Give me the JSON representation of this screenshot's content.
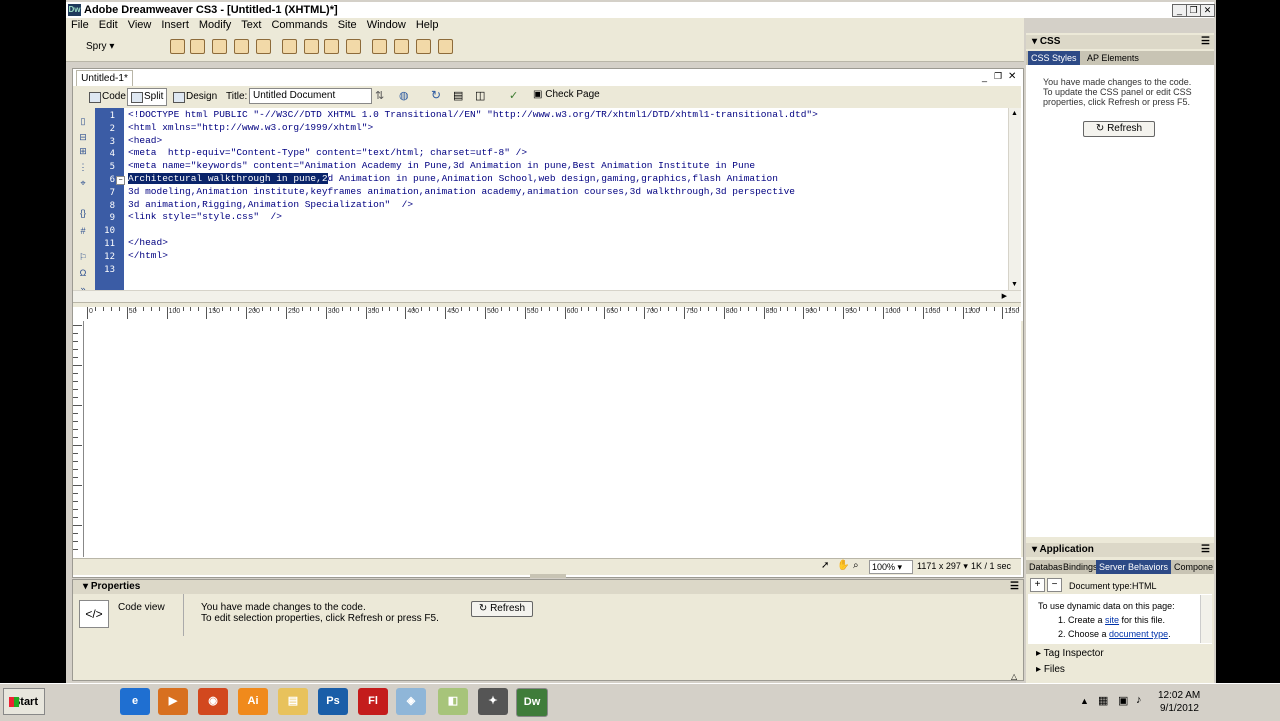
{
  "window": {
    "title": "Adobe Dreamweaver CS3 - [Untitled-1 (XHTML)*]",
    "logo": "Dw"
  },
  "menu": [
    "File",
    "Edit",
    "View",
    "Insert",
    "Modify",
    "Text",
    "Commands",
    "Site",
    "Window",
    "Help"
  ],
  "insert_bar": {
    "category": "Spry"
  },
  "document": {
    "tab": "Untitled-1*",
    "views": {
      "code": "Code",
      "split": "Split",
      "design": "Design",
      "active": "Split"
    },
    "title_label": "Title:",
    "title_value": "Untitled Document",
    "check_page": "Check Page"
  },
  "code_lines": [
    {
      "n": "1",
      "text": "<!DOCTYPE html PUBLIC \"-//W3C//DTD XHTML 1.0 Transitional//EN\" \"http://www.w3.org/TR/xhtml1/DTD/xhtml1-transitional.dtd\">"
    },
    {
      "n": "2",
      "text": "<html xmlns=\"http://www.w3.org/1999/xhtml\">"
    },
    {
      "n": "3",
      "text": "<head>"
    },
    {
      "n": "4",
      "text": "<meta  http-equiv=\"Content-Type\" content=\"text/html; charset=utf-8\" />"
    },
    {
      "n": "5",
      "text": "<meta name=\"keywords\" content=\"Animation Academy in Pune,3d Animation in pune,Best Animation Institute in Pune"
    },
    {
      "n": "6",
      "selected": "Architectural walkthrough in pune,2",
      "text": "d Animation in pune,Animation School,web design,gaming,graphics,flash Animation"
    },
    {
      "n": "7",
      "text": "3d modeling,Animation institute,keyframes animation,animation academy,animation courses,3d walkthrough,3d perspective"
    },
    {
      "n": "8",
      "text": "3d animation,Rigging,Animation Specialization\"  />"
    },
    {
      "n": "9",
      "text": "<link style=\"style.css\"  />"
    },
    {
      "n": "10",
      "text": ""
    },
    {
      "n": "11",
      "text": "</head>"
    },
    {
      "n": "12",
      "text": "</html>"
    },
    {
      "n": "13",
      "text": ""
    }
  ],
  "ruler_labels": [
    "0",
    "50",
    "100",
    "150",
    "200",
    "250",
    "300",
    "350",
    "400",
    "450",
    "500",
    "550",
    "600",
    "650",
    "700",
    "750",
    "800",
    "850",
    "900",
    "950",
    "1000",
    "1050",
    "1100",
    "1150"
  ],
  "status": {
    "zoom": "100%",
    "size": "1171 x 297",
    "download": "1K / 1 sec"
  },
  "properties": {
    "title": "Properties",
    "mode": "Code view",
    "msg1": "You have made changes to the code.",
    "msg2": "To edit selection properties, click Refresh or press F5.",
    "refresh": "Refresh"
  },
  "css_panel": {
    "title": "CSS",
    "tabs": [
      "CSS Styles",
      "AP Elements"
    ],
    "msg": [
      "You have made changes to the code.",
      "To update the CSS panel or edit CSS",
      "properties, click Refresh or press F5."
    ],
    "refresh": "Refresh"
  },
  "app_panel": {
    "title": "Application",
    "tabs": [
      "Databas",
      "Bindings",
      "Server Behaviors",
      "Compone"
    ],
    "doc_type": "Document type:HTML",
    "intro": "To use dynamic data on this page:",
    "step1_pre": "1.  Create a ",
    "step1_link": "site",
    "step1_post": " for this file.",
    "step2_pre": "2.  Choose a ",
    "step2_link": "document type",
    "step2_post": "."
  },
  "collapsed_panels": [
    "Tag Inspector",
    "Files"
  ],
  "taskbar": {
    "start": "Start",
    "apps": [
      {
        "label": "e",
        "color": "#1f6fd1"
      },
      {
        "label": "▶",
        "color": "#d8701f"
      },
      {
        "label": "◉",
        "color": "#d2481e"
      },
      {
        "label": "Ai",
        "color": "#f08a1c"
      },
      {
        "label": "▤",
        "color": "#e8c25c"
      },
      {
        "label": "Ps",
        "color": "#1a5ea8"
      },
      {
        "label": "Fl",
        "color": "#c41c1c"
      },
      {
        "label": "◈",
        "color": "#8fb6d8"
      },
      {
        "label": "◧",
        "color": "#a7c47a"
      },
      {
        "label": "✦",
        "color": "#555555"
      },
      {
        "label": "Dw",
        "color": "#3f7c3a"
      }
    ],
    "time": "12:02 AM",
    "date": "9/1/2012"
  }
}
